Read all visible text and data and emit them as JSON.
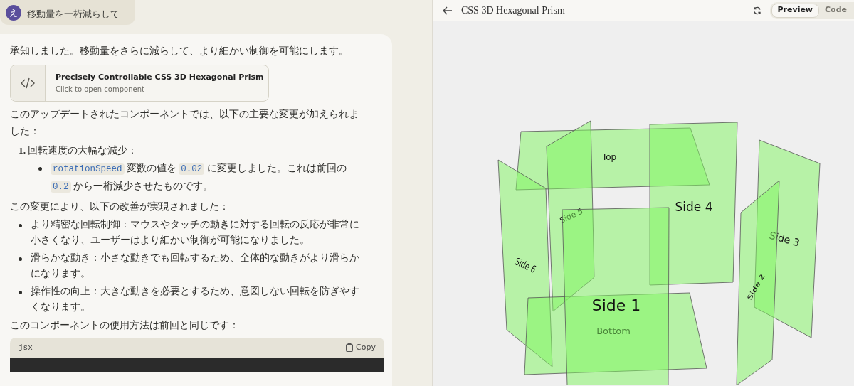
{
  "user_message": {
    "avatar": "え",
    "text": "移動量を一桁減らして"
  },
  "response": {
    "intro": "承知しました。移動量をさらに減らして、より細かい制御を可能にします。",
    "artifact": {
      "title": "Precisely Controllable CSS 3D Hexagonal Prism",
      "subtitle": "Click to open component"
    },
    "paragraph_1": "このアップデートされたコンポーネントでは、以下の主要な変更が加えられました：",
    "numbered_list": [
      {
        "number": "1.",
        "text": "回転速度の大幅な減少：",
        "bullets": [
          [
            {
              "kind": "code",
              "text": "rotationSpeed"
            },
            {
              "kind": "text",
              "text": " 変数の値を "
            },
            {
              "kind": "code",
              "text": "0.02"
            },
            {
              "kind": "text",
              "text": " に変更しました。これは前回の "
            },
            {
              "kind": "code",
              "text": "0.2"
            },
            {
              "kind": "text",
              "text": " から一桁減少させたものです。"
            }
          ]
        ]
      }
    ],
    "paragraph_2": "この変更により、以下の改善が実現されました：",
    "bullets": [
      "より精密な回転制御：マウスやタッチの動きに対する回転の反応が非常に小さくなり、ユーザーはより細かい制御が可能になりました。",
      "滑らかな動き：小さな動きでも回転するため、全体的な動きがより滑らかになります。",
      "操作性の向上：大きな動きを必要とするため、意図しない回転を防ぎやすくなります。"
    ],
    "paragraph_3": "このコンポーネントの使用方法は前回と同じです：",
    "code_block": {
      "language": "jsx",
      "copy_label": "Copy"
    }
  },
  "preview": {
    "title": "CSS 3D Hexagonal Prism",
    "tabs": [
      {
        "label": "Preview",
        "selected": true
      },
      {
        "label": "Code",
        "selected": false
      }
    ],
    "faces": [
      {
        "label": "Top"
      },
      {
        "label": "Side 5"
      },
      {
        "label": "Side 4"
      },
      {
        "label": "Side 6"
      },
      {
        "label": "Side 3"
      },
      {
        "label": "Side 2"
      },
      {
        "label": "Side 1"
      },
      {
        "label": "Bottom"
      }
    ]
  }
}
